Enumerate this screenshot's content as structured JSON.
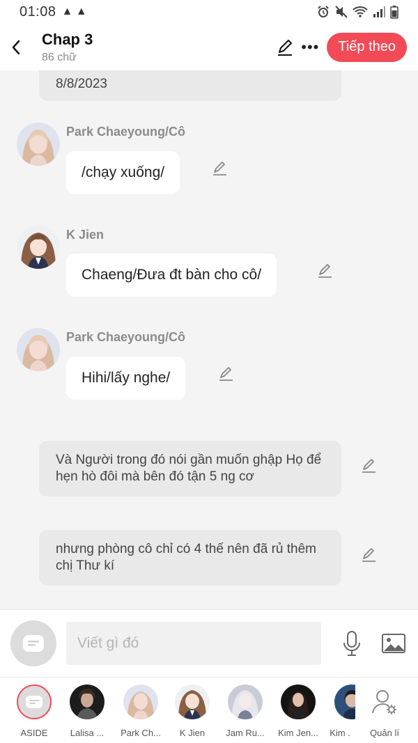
{
  "status_bar": {
    "time": "01:08",
    "warnings": "▲ ▲"
  },
  "header": {
    "title": "Chap 3",
    "subtitle": "86 chữ",
    "next_label": "Tiếp theo"
  },
  "chat": {
    "top_narration": "8/8/2023",
    "messages": [
      {
        "speaker": "Park Chaeyoung/Cô",
        "text": "/chạy xuống/",
        "avatar": "chaeyoung"
      },
      {
        "speaker": "K Jien",
        "text": "Chaeng/Đưa đt bàn cho cô/",
        "avatar": "jien"
      },
      {
        "speaker": "Park Chaeyoung/Cô",
        "text": "Hihi/lấy nghe/",
        "avatar": "chaeyoung"
      }
    ],
    "narrations": [
      "Và Người trong đó nói gần muốn ghập Họ để hẹn hò đôi mà bên đó tận 5 ng cơ",
      "nhưng phòng cô chỉ có 4 thế nên đã rủ thêm chị Thư kí"
    ]
  },
  "input": {
    "placeholder": "Viết gì đó"
  },
  "characters": [
    {
      "label": "ASIDE"
    },
    {
      "label": "Lalisa ..."
    },
    {
      "label": "Park Ch..."
    },
    {
      "label": "K Jien"
    },
    {
      "label": "Jam Ru..."
    },
    {
      "label": "Kim Jen..."
    },
    {
      "label": "Kim ."
    },
    {
      "label": "Quản lí"
    }
  ],
  "colors": {
    "accent": "#f24a56",
    "narration_bg": "#e9e9e9",
    "chat_bg": "#f4f4f4"
  }
}
